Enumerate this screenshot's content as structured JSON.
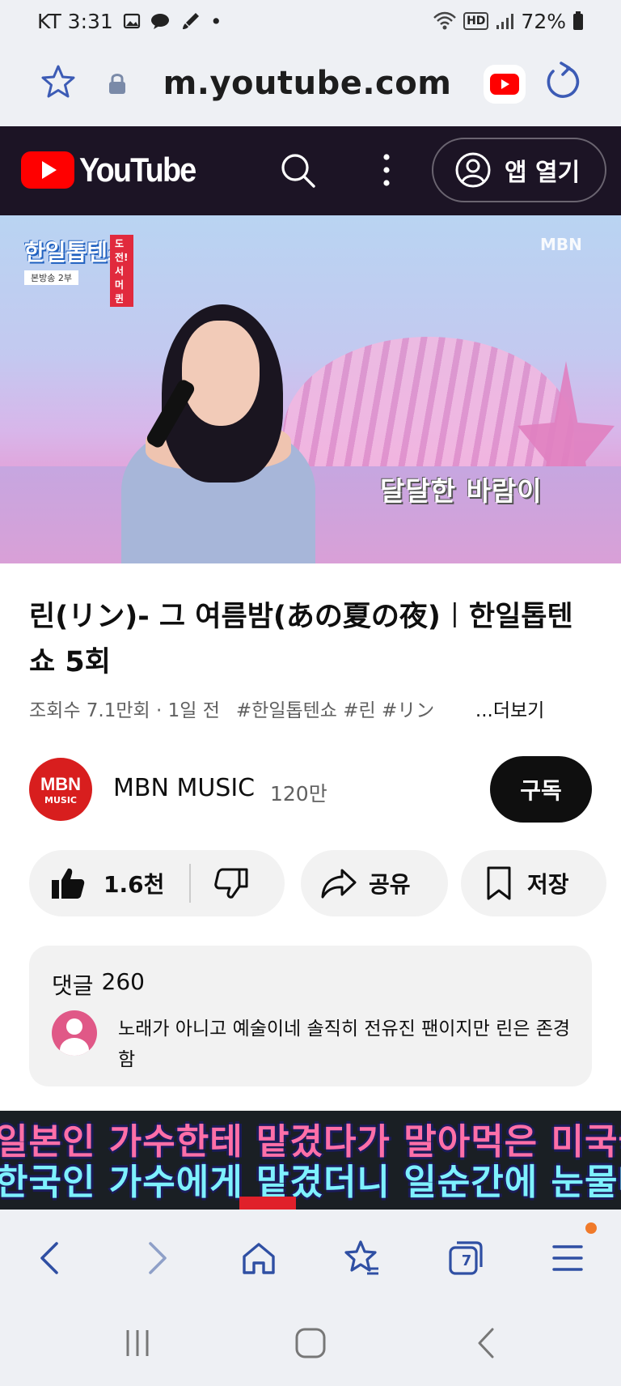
{
  "status_bar": {
    "carrier_time": "KT 3:31",
    "dot": "•",
    "hd": "HD",
    "battery": "72%"
  },
  "browser": {
    "url": "m.youtube.com"
  },
  "youtube_header": {
    "logo_text": "YouTube",
    "open_app_label": "앱 열기"
  },
  "video": {
    "show_logo": "한일톱텐쇼",
    "show_badge": "도전! 서머 퀸",
    "show_sub": "본방송 2부",
    "broadcaster": "MBN",
    "caption": "달달한 바람이"
  },
  "info": {
    "title": "린(リン)- 그 여름밤(あの夏の夜)︱한일톱텐쇼 5회",
    "views": "조회수 7.1만회 · 1일 전",
    "hashtags": "#한일톱텐쇼 #린 #リン",
    "more": "...더보기"
  },
  "channel": {
    "avatar_top": "MBN",
    "avatar_bottom": "MUSIC",
    "name": "MBN MUSIC",
    "subscribers": "120만",
    "subscribe_label": "구독"
  },
  "actions": {
    "like_count": "1.6천",
    "share_label": "공유",
    "save_label": "저장"
  },
  "comments": {
    "label": "댓글",
    "count": "260",
    "top_comment": "노래가 아니고 예술이네 솔직히 전유진 팬이지만 린은 존경함"
  },
  "next_video": {
    "line1": "일본인 가수한테 맡겼다가 말아먹은 미국국가를",
    "line2": "한국인 가수에게 맡겼더니 일순간에 눈물바다 된 상황"
  },
  "toolbar": {
    "tab_count": "7"
  },
  "colors": {
    "youtube_red": "#ff0000",
    "header_bg": "#1c1425",
    "browser_accent": "#2f4fa3"
  }
}
